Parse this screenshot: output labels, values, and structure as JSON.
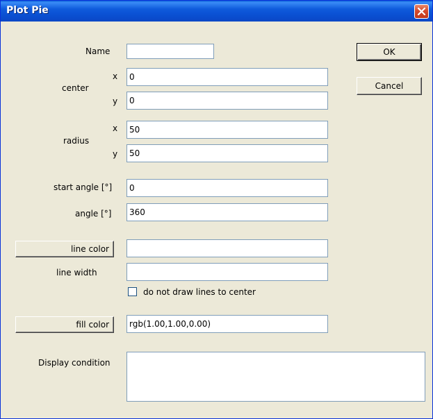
{
  "window": {
    "title": "Plot Pie"
  },
  "icons": {
    "close": "close-icon"
  },
  "name": {
    "label": "Name",
    "value": ""
  },
  "center": {
    "label": "center",
    "x_label": "x",
    "y_label": "y",
    "x_value": "0",
    "y_value": "0"
  },
  "radius": {
    "label": "radius",
    "x_label": "x",
    "y_label": "y",
    "x_value": "50",
    "y_value": "50"
  },
  "start_angle": {
    "label": "start angle [°]",
    "value": "0"
  },
  "angle": {
    "label": "angle [°]",
    "value": "360"
  },
  "line_color": {
    "button_label": "line color",
    "value": ""
  },
  "line_width": {
    "label": "line width",
    "value": ""
  },
  "lines_to_center": {
    "label": "do not draw lines to center",
    "checked": false
  },
  "fill_color": {
    "button_label": "fill color",
    "value": "rgb(1.00,1.00,0.00)"
  },
  "display_condition": {
    "label": "Display condition",
    "value": ""
  },
  "buttons": {
    "ok": "OK",
    "cancel": "Cancel"
  },
  "colors": {
    "titlebar": "#0a55d6",
    "dialog_bg": "#ece9d8",
    "field_border": "#7f9db9",
    "close_button": "#d5492b"
  }
}
